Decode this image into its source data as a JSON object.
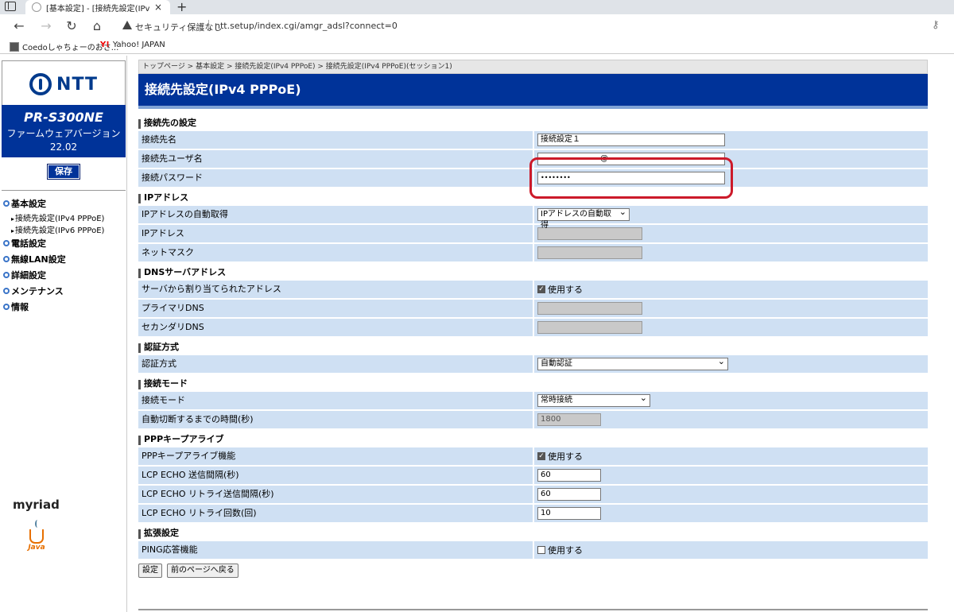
{
  "browser": {
    "tab_title": "[基本設定] - [接続先設定(IPv4 PP",
    "tab_close": "×",
    "new_tab": "+",
    "security_label": "セキュリティ保護なし",
    "url": "ntt.setup/index.cgi/amgr_adsl?connect=0",
    "bookmarks": [
      "Coedoしゃちょーのおさ...",
      "Yahoo! JAPAN"
    ],
    "yahoo_mark": "Y!"
  },
  "sidebar": {
    "logo": "NTT",
    "model": "PR-S300NE",
    "fw_label": "ファームウェアバージョン",
    "fw_version": "22.02",
    "save_label": "保存",
    "menu": {
      "basic": "基本設定",
      "sub_ipv4": "接続先設定(IPv4 PPPoE)",
      "sub_ipv6": "接続先設定(IPv6 PPPoE)",
      "phone": "電話設定",
      "wlan": "無線LAN設定",
      "advanced": "詳細設定",
      "maintenance": "メンテナンス",
      "info": "情報"
    },
    "myriad": "myriad",
    "java": "Java"
  },
  "main": {
    "breadcrumb": "トップページ > 基本設定 > 接続先設定(IPv4 PPPoE) > 接続先設定(IPv4 PPPoE)(セッション1)",
    "title": "接続先設定(IPv4 PPPoE)",
    "sections": {
      "dest": "接続先の設定",
      "ip": "IPアドレス",
      "dns": "DNSサーバアドレス",
      "auth": "認証方式",
      "mode": "接続モード",
      "keepalive": "PPPキープアライブ",
      "ext": "拡張設定"
    },
    "rows": {
      "dest_name": {
        "label": "接続先名",
        "value": "接続設定１"
      },
      "user": {
        "label": "接続先ユーザ名",
        "value": "@"
      },
      "password": {
        "label": "接続パスワード",
        "value": "••••••••"
      },
      "ip_auto": {
        "label": "IPアドレスの自動取得",
        "value": "IPアドレスの自動取得"
      },
      "ip_addr": {
        "label": "IPアドレス",
        "value": ""
      },
      "netmask": {
        "label": "ネットマスク",
        "value": ""
      },
      "dns_server": {
        "label": "サーバから割り当てられたアドレス",
        "value": "使用する"
      },
      "dns_primary": {
        "label": "プライマリDNS",
        "value": ""
      },
      "dns_secondary": {
        "label": "セカンダリDNS",
        "value": ""
      },
      "auth_method": {
        "label": "認証方式",
        "value": "自動認証"
      },
      "conn_mode": {
        "label": "接続モード",
        "value": "常時接続"
      },
      "auto_disconnect": {
        "label": "自動切断するまでの時間(秒)",
        "value": "1800"
      },
      "ppp_keepalive": {
        "label": "PPPキープアライブ機能",
        "value": "使用する"
      },
      "lcp_interval": {
        "label": "LCP ECHO 送信間隔(秒)",
        "value": "60"
      },
      "lcp_retry_interval": {
        "label": "LCP ECHO リトライ送信間隔(秒)",
        "value": "60"
      },
      "lcp_retry_count": {
        "label": "LCP ECHO リトライ回数(回)",
        "value": "10"
      },
      "ping": {
        "label": "PING応答機能",
        "value": "使用する"
      }
    },
    "buttons": {
      "set": "設定",
      "back": "前のページへ戻る"
    }
  },
  "colors": {
    "brand_blue": "#003399",
    "row_bg": "#cfe0f3",
    "highlight_red": "#cc1a2a"
  }
}
